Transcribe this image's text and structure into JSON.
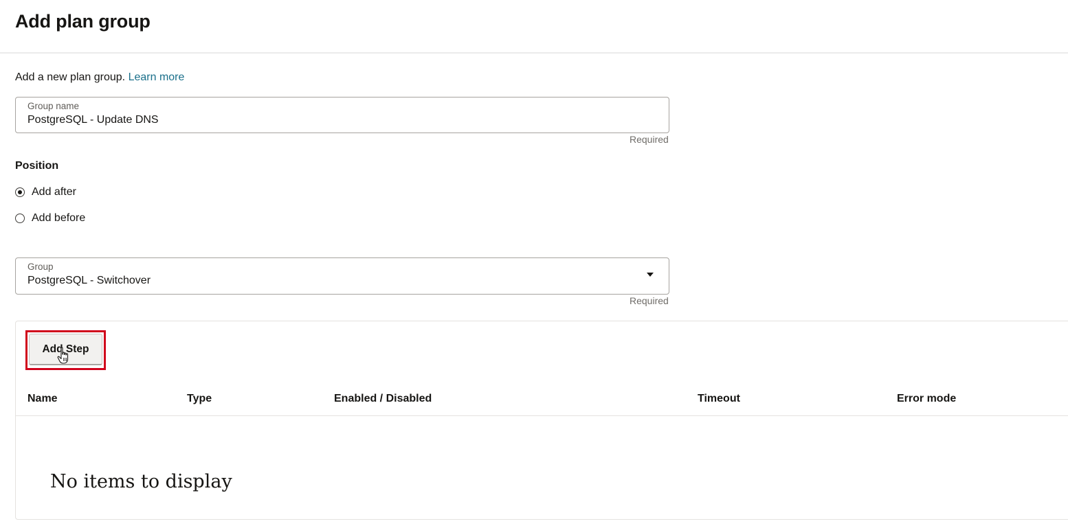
{
  "header": {
    "title": "Add plan group"
  },
  "intro": {
    "text": "Add a new plan group.",
    "link_text": "Learn more"
  },
  "group_name_field": {
    "label": "Group name",
    "value": "PostgreSQL - Update DNS",
    "hint": "Required"
  },
  "position": {
    "label": "Position",
    "options": [
      {
        "label": "Add after",
        "selected": true
      },
      {
        "label": "Add before",
        "selected": false
      }
    ]
  },
  "group_select": {
    "label": "Group",
    "value": "PostgreSQL - Switchover",
    "hint": "Required"
  },
  "steps": {
    "add_button_label": "Add Step",
    "columns": [
      "Name",
      "Type",
      "Enabled / Disabled",
      "Timeout",
      "Error mode"
    ],
    "empty_message": "No items to display"
  },
  "colors": {
    "link": "#1a6f8a",
    "highlight": "#d0021b",
    "text": "#161513"
  }
}
